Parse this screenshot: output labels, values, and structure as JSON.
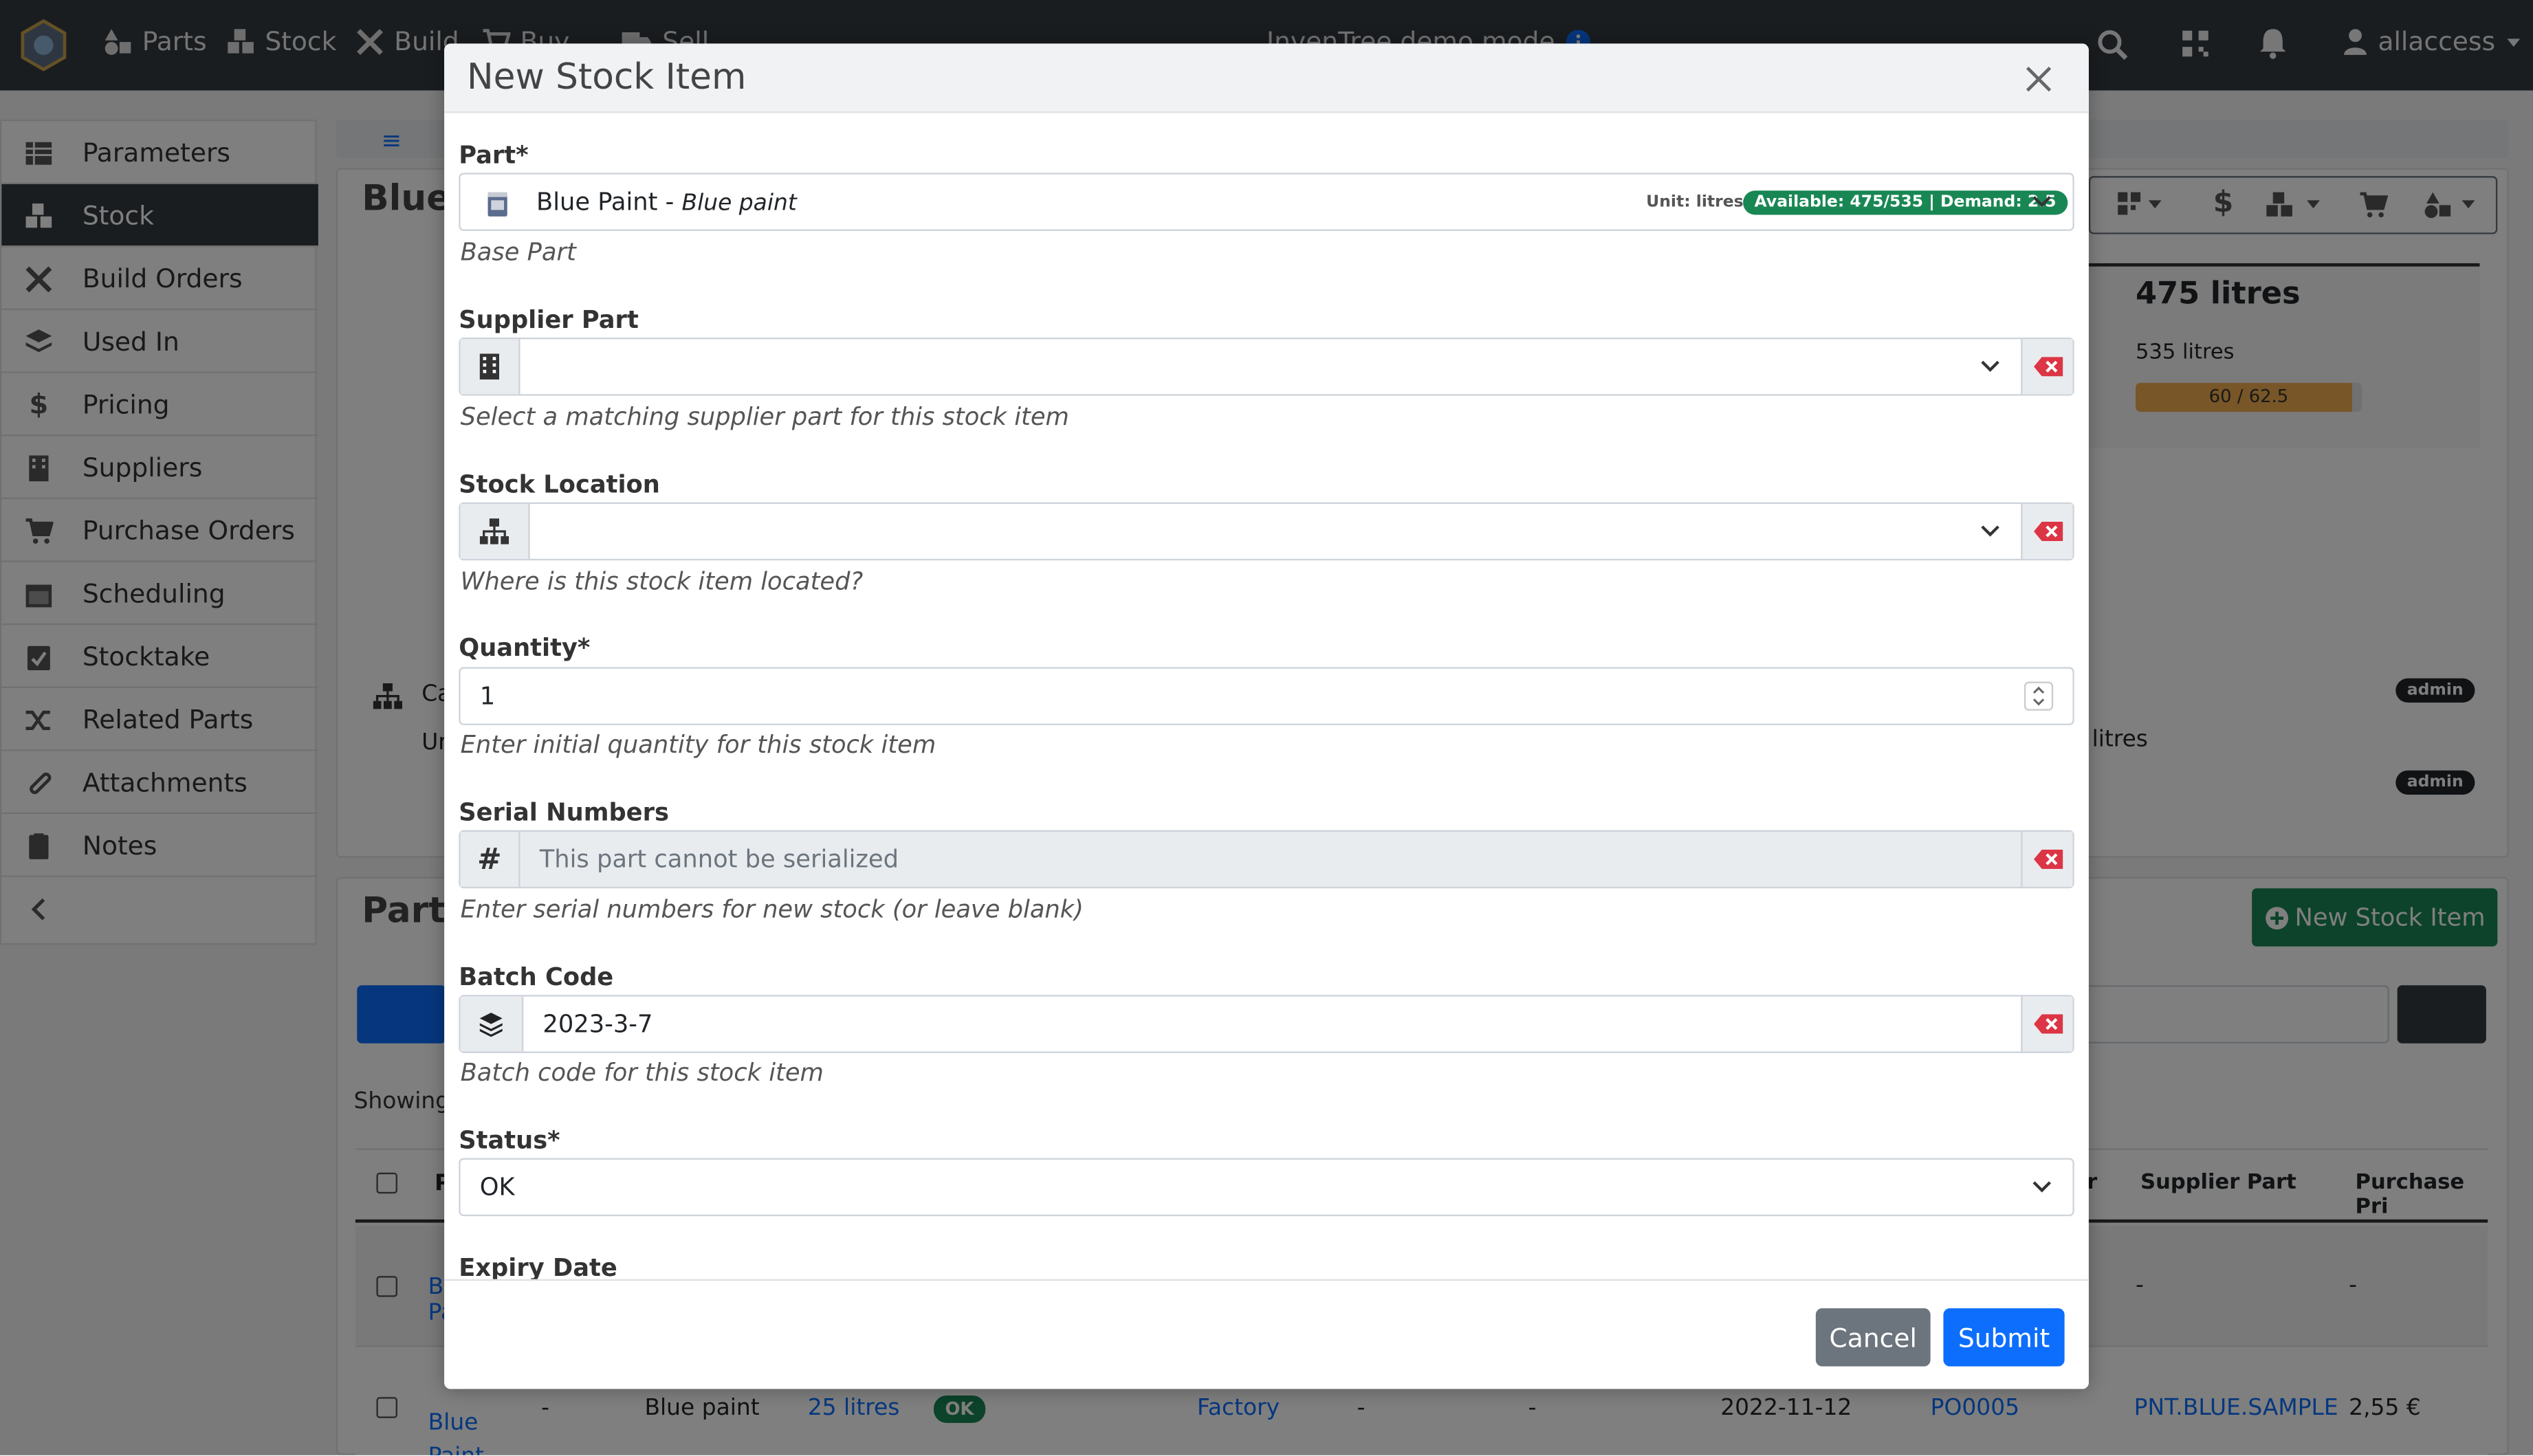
{
  "navbar": {
    "items": [
      "Parts",
      "Stock",
      "Build",
      "Buy",
      "Sell"
    ],
    "demo_banner": "InvenTree demo mode",
    "user": "allaccess"
  },
  "sidebar": {
    "items": [
      {
        "label": "Parameters",
        "icon": "table-icon"
      },
      {
        "label": "Stock",
        "icon": "boxes-icon",
        "active": true
      },
      {
        "label": "Build Orders",
        "icon": "tools-icon"
      },
      {
        "label": "Used In",
        "icon": "layers-icon"
      },
      {
        "label": "Pricing",
        "icon": "dollar-icon"
      },
      {
        "label": "Suppliers",
        "icon": "building-icon"
      },
      {
        "label": "Purchase Orders",
        "icon": "cart-icon"
      },
      {
        "label": "Scheduling",
        "icon": "calendar-icon"
      },
      {
        "label": "Stocktake",
        "icon": "clipboard-check-icon"
      },
      {
        "label": "Related Parts",
        "icon": "random-icon"
      },
      {
        "label": "Attachments",
        "icon": "paperclip-icon"
      },
      {
        "label": "Notes",
        "icon": "clipboard-icon"
      }
    ],
    "collapse_icon": "chevron-left-icon"
  },
  "background": {
    "part_title_fragment": "Blue",
    "stock_total": "475 litres",
    "stock_available": "535 litres",
    "progress_label": "60 / 62.5",
    "progress_fraction": 0.96,
    "badge_admin": "admin",
    "litres_fragment": "litres",
    "category_fragment": "Ca",
    "units_fragment": "Ur",
    "section_title_fragment": "Part",
    "new_stock_button": "New Stock Item",
    "showing_fragment": "Showing",
    "table_headers": {
      "supplier_part": "Supplier Part",
      "purchase_price": "Purchase Pri",
      "fragment_p": "P",
      "fragment_er": "er"
    },
    "row1": {
      "part": "Bl Pa",
      "supplier_part": "-",
      "purchase_price": "-"
    },
    "row2": {
      "part_line1": "Blue",
      "part_line2": "Paint",
      "ipn": "-",
      "description": "Blue paint",
      "quantity": "25 litres",
      "status": "OK",
      "location": "Factory",
      "batch": "-",
      "serial": "-",
      "date": "2022-11-12",
      "po": "PO0005",
      "supplier_part": "PNT.BLUE.SAMPLE",
      "price": "2,55 €"
    }
  },
  "modal": {
    "title": "New Stock Item",
    "part": {
      "label": "Part*",
      "value_name": "Blue Paint - ",
      "value_desc": "Blue paint",
      "unit": "Unit: litres",
      "availability": "Available: 475/535 | Demand: 2.5",
      "help": "Base Part"
    },
    "supplier_part": {
      "label": "Supplier Part",
      "value": "",
      "help": "Select a matching supplier part for this stock item"
    },
    "stock_location": {
      "label": "Stock Location",
      "value": "",
      "help": "Where is this stock item located?"
    },
    "quantity": {
      "label": "Quantity*",
      "value": "1",
      "help": "Enter initial quantity for this stock item"
    },
    "serial_numbers": {
      "label": "Serial Numbers",
      "placeholder": "This part cannot be serialized",
      "help": "Enter serial numbers for new stock (or leave blank)"
    },
    "batch_code": {
      "label": "Batch Code",
      "value": "2023-3-7",
      "help": "Batch code for this stock item"
    },
    "status": {
      "label": "Status*",
      "value": "OK"
    },
    "expiry_date": {
      "label": "Expiry Date"
    },
    "buttons": {
      "cancel": "Cancel",
      "submit": "Submit"
    }
  },
  "colors": {
    "navbar": "#343a40",
    "primary": "#0d6efd",
    "success": "#198754",
    "secondary": "#6c757d",
    "danger": "#dc3545",
    "warning": "#f0ad4e"
  }
}
